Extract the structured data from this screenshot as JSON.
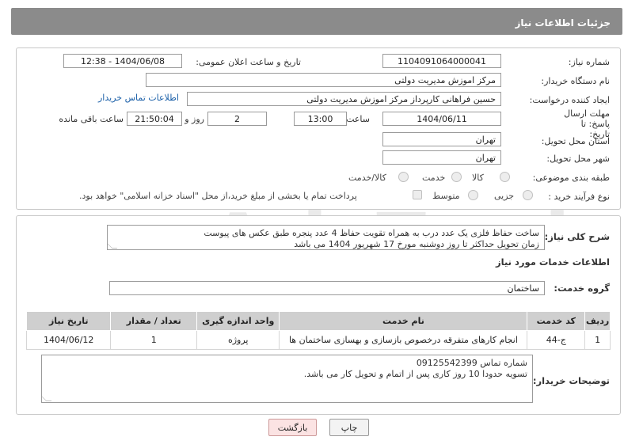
{
  "header": {
    "title": "جزئیات اطلاعات نیاز"
  },
  "fields": {
    "need_number_label": "شماره نیاز:",
    "need_number": "1104091064000041",
    "announce_label": "تاریخ و ساعت اعلان عمومی:",
    "announce_value": "1404/06/08 - 12:38",
    "buyer_org_label": "نام دستگاه خریدار:",
    "buyer_org": "مرکز اموزش مدیریت دولتی",
    "creator_label": "ایجاد کننده درخواست:",
    "creator": "حسین  فراهانی کارپرداز مرکز اموزش مدیریت دولتی",
    "buyer_contact_link": "اطلاعات تماس خریدار",
    "deadline_label": "مهلت ارسال پاسخ: تا تاریخ:",
    "deadline_date": "1404/06/11",
    "time_label": "ساعت",
    "deadline_time": "13:00",
    "days_value": "2",
    "days_label": "روز و",
    "remaining_time": "21:50:04",
    "remaining_label": "ساعت باقی مانده",
    "province_label": "استان محل تحویل:",
    "province": "تهران",
    "city_label": "شهر محل تحویل:",
    "city": "تهران",
    "category_label": "طبقه بندی موضوعی:",
    "category_options": [
      "کالا",
      "خدمت",
      "کالا/خدمت"
    ],
    "process_label": "نوع فرآیند خرید :",
    "process_options": [
      "جزیی",
      "متوسط"
    ],
    "payment_note": "پرداخت تمام یا بخشی از مبلغ خرید،از محل \"اسناد خزانه اسلامی\" خواهد بود."
  },
  "description": {
    "label": "شرح کلی نیاز:",
    "line1": "ساخت حفاظ فلزی یک عدد درب به همراه تقویت حفاظ 4 عدد پنجره طبق عکس های پیوست",
    "line2": "زمان تحویل حداکثر تا روز دوشنبه مورخ 17 شهریور 1404 می باشد"
  },
  "services": {
    "section_title": "اطلاعات خدمات مورد نیاز",
    "group_label": "گروه خدمت:",
    "group_value": "ساختمان",
    "columns": [
      "ردیف",
      "کد خدمت",
      "نام خدمت",
      "واحد اندازه گیری",
      "تعداد / مقدار",
      "تاریخ نیاز"
    ],
    "rows": [
      [
        "1",
        "ج-44",
        "انجام کارهای متفرقه درخصوص بازسازی و بهسازی ساختمان ها",
        "پروژه",
        "1",
        "1404/06/12"
      ]
    ]
  },
  "buyer_notes": {
    "label": "توضیحات خریدار:",
    "line1": "شماره تماس 09125542399",
    "line2": "تسویه حدودا 10 روز کاری پس از اتمام و تحویل کار می باشد."
  },
  "buttons": {
    "print": "چاپ",
    "back": "بازگشت"
  },
  "watermark_text": "AriaTender.neT"
}
